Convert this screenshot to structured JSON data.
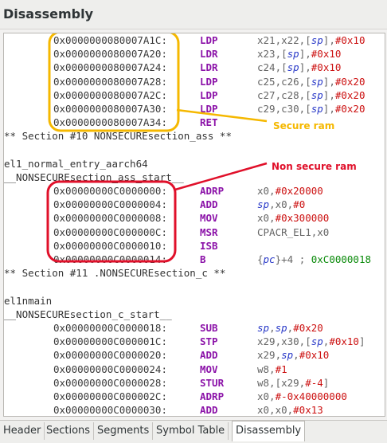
{
  "window": {
    "title": "Disassembly"
  },
  "disassembly": [
    {
      "kind": "insn",
      "addr": "0x0000000080007A1C:",
      "mn": "LDP",
      "ops": [
        [
          "r",
          "x21,x22,["
        ],
        [
          "ri",
          "sp"
        ],
        [
          "r",
          "],"
        ],
        [
          "i",
          "#0x10"
        ]
      ]
    },
    {
      "kind": "insn",
      "addr": "0x0000000080007A20:",
      "mn": "LDR",
      "ops": [
        [
          "r",
          "x23,["
        ],
        [
          "ri",
          "sp"
        ],
        [
          "r",
          "],"
        ],
        [
          "i",
          "#0x10"
        ]
      ]
    },
    {
      "kind": "insn",
      "addr": "0x0000000080007A24:",
      "mn": "LDR",
      "ops": [
        [
          "r",
          "c24,["
        ],
        [
          "ri",
          "sp"
        ],
        [
          "r",
          "],"
        ],
        [
          "i",
          "#0x10"
        ]
      ]
    },
    {
      "kind": "insn",
      "addr": "0x0000000080007A28:",
      "mn": "LDP",
      "ops": [
        [
          "r",
          "c25,c26,["
        ],
        [
          "ri",
          "sp"
        ],
        [
          "r",
          "],"
        ],
        [
          "i",
          "#0x20"
        ]
      ]
    },
    {
      "kind": "insn",
      "addr": "0x0000000080007A2C:",
      "mn": "LDP",
      "ops": [
        [
          "r",
          "c27,c28,["
        ],
        [
          "ri",
          "sp"
        ],
        [
          "r",
          "],"
        ],
        [
          "i",
          "#0x20"
        ]
      ]
    },
    {
      "kind": "insn",
      "addr": "0x0000000080007A30:",
      "mn": "LDP",
      "ops": [
        [
          "r",
          "c29,c30,["
        ],
        [
          "ri",
          "sp"
        ],
        [
          "r",
          "],"
        ],
        [
          "i",
          "#0x20"
        ]
      ]
    },
    {
      "kind": "insn",
      "addr": "0x0000000080007A34:",
      "mn": "RET",
      "ops": []
    },
    {
      "kind": "text",
      "text": "** Section #10 NONSECUREsection_ass **"
    },
    {
      "kind": "blank"
    },
    {
      "kind": "text",
      "text": "el1_normal_entry_aarch64"
    },
    {
      "kind": "text",
      "text": "__NONSECUREsection_ass_start__"
    },
    {
      "kind": "insn",
      "addr": "0x00000000C0000000:",
      "mn": "ADRP",
      "ops": [
        [
          "r",
          "x0,"
        ],
        [
          "i",
          "#0x20000"
        ]
      ]
    },
    {
      "kind": "insn",
      "addr": "0x00000000C0000004:",
      "mn": "ADD",
      "ops": [
        [
          "ri",
          "sp"
        ],
        [
          "r",
          ",x0,"
        ],
        [
          "i",
          "#0"
        ]
      ]
    },
    {
      "kind": "insn",
      "addr": "0x00000000C0000008:",
      "mn": "MOV",
      "ops": [
        [
          "r",
          "x0,"
        ],
        [
          "i",
          "#0x300000"
        ]
      ]
    },
    {
      "kind": "insn",
      "addr": "0x00000000C000000C:",
      "mn": "MSR",
      "ops": [
        [
          "r",
          "CPACR_EL1,x0"
        ]
      ]
    },
    {
      "kind": "insn",
      "addr": "0x00000000C0000010:",
      "mn": "ISB",
      "ops": []
    },
    {
      "kind": "insn",
      "addr": "0x00000000C0000014:",
      "mn": "B",
      "ops": [
        [
          "r",
          "{"
        ],
        [
          "ri",
          "pc"
        ],
        [
          "r",
          "}+4 ; "
        ],
        [
          "c",
          "0xC0000018"
        ]
      ]
    },
    {
      "kind": "text",
      "text": "** Section #11 .NONSECUREsection_c **"
    },
    {
      "kind": "blank"
    },
    {
      "kind": "text",
      "text": "el1nmain"
    },
    {
      "kind": "text",
      "text": "__NONSECUREsection_c_start__"
    },
    {
      "kind": "insn",
      "addr": "0x00000000C0000018:",
      "mn": "SUB",
      "ops": [
        [
          "ri",
          "sp"
        ],
        [
          "r",
          ","
        ],
        [
          "ri",
          "sp"
        ],
        [
          "r",
          ","
        ],
        [
          "i",
          "#0x20"
        ]
      ]
    },
    {
      "kind": "insn",
      "addr": "0x00000000C000001C:",
      "mn": "STP",
      "ops": [
        [
          "r",
          "x29,x30,["
        ],
        [
          "ri",
          "sp"
        ],
        [
          "r",
          ","
        ],
        [
          "i",
          "#0x10"
        ],
        [
          "r",
          "]"
        ]
      ]
    },
    {
      "kind": "insn",
      "addr": "0x00000000C0000020:",
      "mn": "ADD",
      "ops": [
        [
          "r",
          "x29,"
        ],
        [
          "ri",
          "sp"
        ],
        [
          "r",
          ","
        ],
        [
          "i",
          "#0x10"
        ]
      ]
    },
    {
      "kind": "insn",
      "addr": "0x00000000C0000024:",
      "mn": "MOV",
      "ops": [
        [
          "r",
          "w8,"
        ],
        [
          "i",
          "#1"
        ]
      ]
    },
    {
      "kind": "insn",
      "addr": "0x00000000C0000028:",
      "mn": "STUR",
      "ops": [
        [
          "r",
          "w8,[x29,"
        ],
        [
          "i",
          "#-4"
        ],
        [
          "r",
          "]"
        ]
      ]
    },
    {
      "kind": "insn",
      "addr": "0x00000000C000002C:",
      "mn": "ADRP",
      "ops": [
        [
          "r",
          "x0,"
        ],
        [
          "i",
          "#-0x40000000"
        ]
      ]
    },
    {
      "kind": "insn",
      "addr": "0x00000000C0000030:",
      "mn": "ADD",
      "ops": [
        [
          "r",
          "x0,x0,"
        ],
        [
          "i",
          "#0x13"
        ]
      ]
    }
  ],
  "annotations": {
    "secure_label": "Secure ram",
    "nonsecure_label": "Non secure ram"
  },
  "colors": {
    "secure": "#f5b800",
    "nonsecure": "#e0102a",
    "mnemonic": "#8b12a8",
    "immediate": "#cc1111"
  },
  "tabs": [
    {
      "label": "Header",
      "active": false
    },
    {
      "label": "Sections",
      "active": false
    },
    {
      "label": "Segments",
      "active": false
    },
    {
      "label": "Symbol Table",
      "active": false
    },
    {
      "label": "Disassembly",
      "active": true
    }
  ]
}
